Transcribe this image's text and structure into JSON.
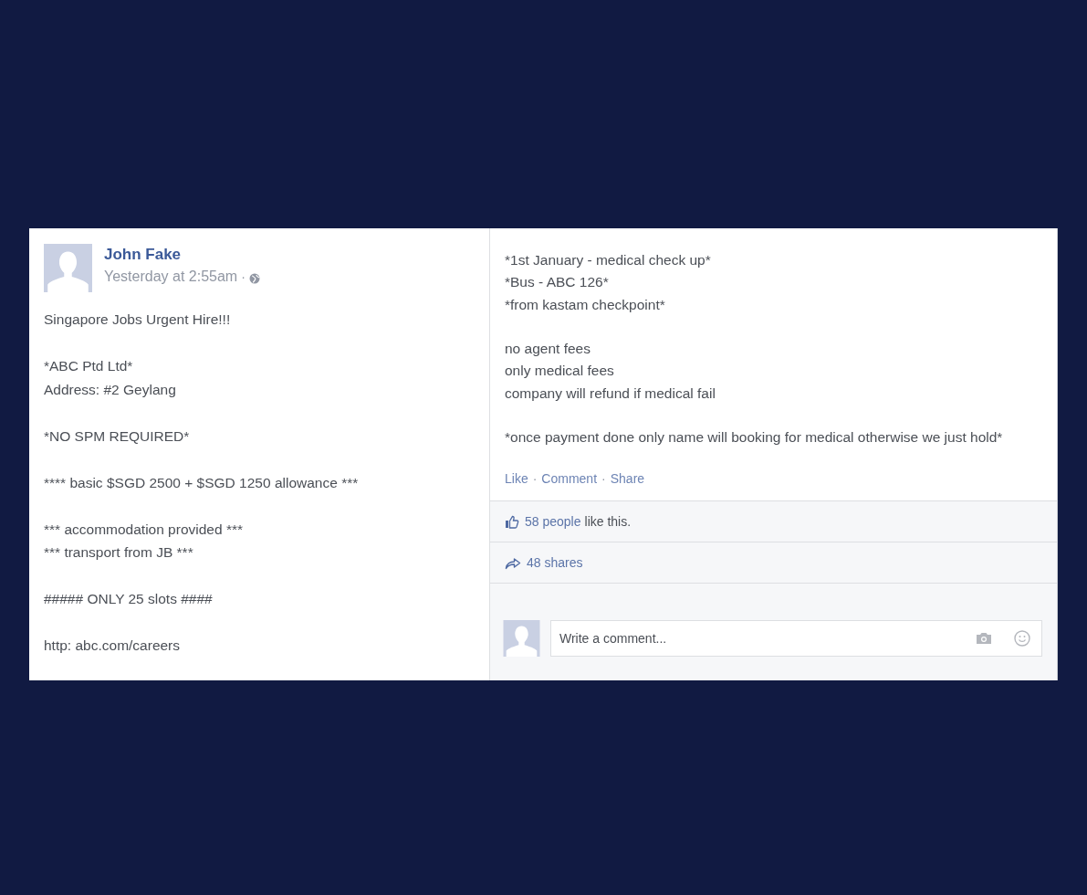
{
  "post": {
    "author": "John Fake",
    "timestamp": "Yesterday at 2:55am",
    "separator": "·",
    "body_left": [
      {
        "lines": [
          "Singapore Jobs Urgent Hire!!!"
        ]
      },
      {
        "lines": [
          "*ABC Ptd Ltd*",
          "Address: #2 Geylang"
        ]
      },
      {
        "lines": [
          "*NO SPM REQUIRED*"
        ]
      },
      {
        "lines": [
          "**** basic $SGD 2500 + $SGD 1250 allowance ***"
        ]
      },
      {
        "lines": [
          "*** accommodation provided ***",
          "*** transport from JB ***"
        ]
      },
      {
        "lines": [
          "##### ONLY 25 slots ####"
        ]
      },
      {
        "lines": [
          "http: abc.com/careers"
        ]
      }
    ],
    "body_right": [
      {
        "lines": [
          "*1st January - medical check up*",
          "*Bus - ABC 126*",
          "*from kastam checkpoint*"
        ]
      },
      {
        "lines": [
          "no agent fees",
          "only medical fees",
          "company will refund if medical fail"
        ]
      },
      {
        "lines": [
          "*once payment done only name will booking for medical otherwise we just hold*"
        ]
      }
    ],
    "actions": [
      "Like",
      "Comment",
      "Share"
    ],
    "likes": {
      "count_link": "58 people",
      "text": "like this."
    },
    "shares": "48 shares",
    "comment_box": {
      "placeholder": "Write a comment..."
    }
  }
}
